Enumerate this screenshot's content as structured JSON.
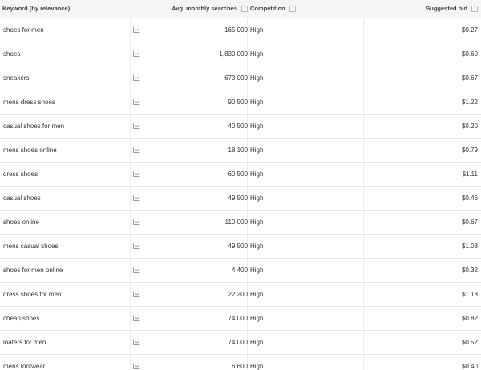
{
  "table": {
    "headers": {
      "keyword": "Keyword (by relevance)",
      "searches": "Avg. monthly searches",
      "competition": "Competition",
      "bid": "Suggested bid"
    },
    "help_glyph": "?",
    "trend_icon": "line-chart-icon",
    "rows": [
      {
        "keyword": "shoes for men",
        "searches": "165,000",
        "competition": "High",
        "bid": "$0.27"
      },
      {
        "keyword": "shoes",
        "searches": "1,830,000",
        "competition": "High",
        "bid": "$0.60"
      },
      {
        "keyword": "sneakers",
        "searches": "673,000",
        "competition": "High",
        "bid": "$0.67"
      },
      {
        "keyword": "mens dress shoes",
        "searches": "90,500",
        "competition": "High",
        "bid": "$1.22"
      },
      {
        "keyword": "casual shoes for men",
        "searches": "40,500",
        "competition": "High",
        "bid": "$0.20"
      },
      {
        "keyword": "mens shoes online",
        "searches": "18,100",
        "competition": "High",
        "bid": "$0.79"
      },
      {
        "keyword": "dress shoes",
        "searches": "60,500",
        "competition": "High",
        "bid": "$1.11"
      },
      {
        "keyword": "casual shoes",
        "searches": "49,500",
        "competition": "High",
        "bid": "$0.46"
      },
      {
        "keyword": "shoes online",
        "searches": "110,000",
        "competition": "High",
        "bid": "$0.67"
      },
      {
        "keyword": "mens casual shoes",
        "searches": "49,500",
        "competition": "High",
        "bid": "$1.08"
      },
      {
        "keyword": "shoes for men online",
        "searches": "4,400",
        "competition": "High",
        "bid": "$0.32"
      },
      {
        "keyword": "dress shoes for men",
        "searches": "22,200",
        "competition": "High",
        "bid": "$1.18"
      },
      {
        "keyword": "cheap shoes",
        "searches": "74,000",
        "competition": "High",
        "bid": "$0.82"
      },
      {
        "keyword": "loafers for men",
        "searches": "74,000",
        "competition": "High",
        "bid": "$0.52"
      },
      {
        "keyword": "mens footwear",
        "searches": "6,600",
        "competition": "High",
        "bid": "$0.40"
      }
    ]
  }
}
